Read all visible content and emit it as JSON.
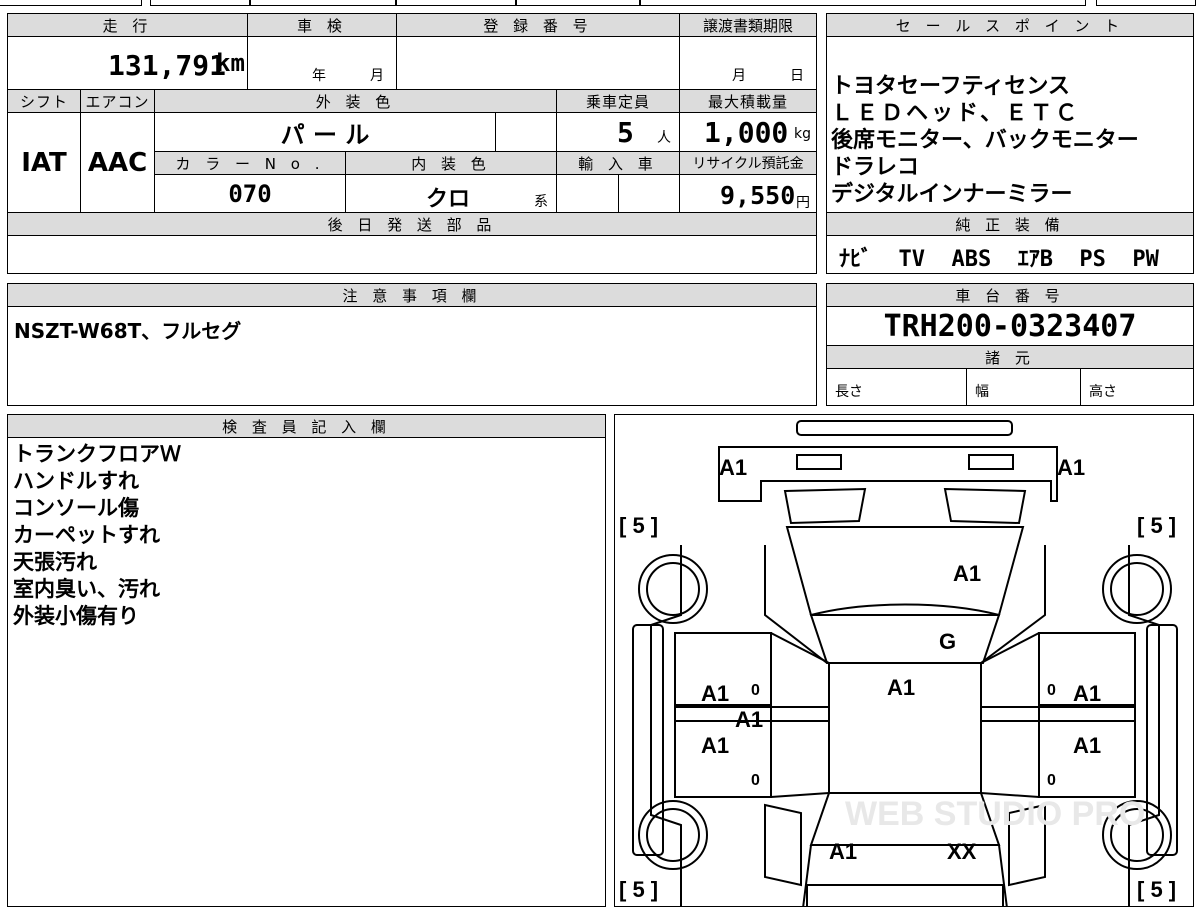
{
  "labels": {
    "mileage": "走 行",
    "inspection": "車 検",
    "registration_no": "登 録 番 号",
    "transfer_deadline": "譲渡書類期限",
    "sales_point": "セ ー ル ス ポ イ ン ト",
    "shift": "シフト",
    "aircon": "エアコン",
    "exterior_color": "外 装 色",
    "capacity": "乗車定員",
    "max_load": "最大積載量",
    "color_no": "カ ラ ー N o .",
    "interior_color": "内 装 色",
    "import": "輸 入 車",
    "recycle": "リサイクル預託金",
    "later_parts": "後 日 発 送 部 品",
    "genuine_equipment": "純 正 装 備",
    "notes": "注 意 事 項 欄",
    "chassis_no": "車 台 番 号",
    "specs": "諸 元",
    "inspector": "検 査 員 記 入 欄"
  },
  "values": {
    "mileage": "131,791",
    "mileage_unit": "km",
    "inspection_year": "年",
    "inspection_month": "月",
    "deadline_month": "月",
    "deadline_day": "日",
    "shift": "IAT",
    "aircon": "AAC",
    "exterior_color": "パ ー ル",
    "capacity": "5",
    "capacity_unit": "人",
    "max_load": "1,000",
    "max_load_unit": "kg",
    "color_no": "070",
    "interior_color": "クロ",
    "interior_suffix": "系",
    "recycle": "9,550",
    "recycle_unit": "円",
    "genuine_equipment": "ﾅﾋﾞ  TV  ABS  ｴｱB  PS  PW",
    "notes": "NSZT-W68T、フルセグ",
    "chassis_no": "TRH200-0323407",
    "spec_length": "長さ",
    "spec_width": "幅",
    "spec_height": "高さ"
  },
  "sales_points": [
    "トヨタセーフティセンス",
    "ＬＥＤヘッド、ＥＴＣ",
    "後席モニター、バックモニター",
    "ドラレコ",
    "デジタルインナーミラー"
  ],
  "inspector_notes": [
    "トランクフロアＷ",
    "ハンドルすれ",
    "コンソール傷",
    "カーペットすれ",
    "天張汚れ",
    "室内臭い、汚れ",
    "外装小傷有り"
  ],
  "diagram": {
    "tire_mark": "[ 5 ]",
    "marks": {
      "top_left": "A1",
      "top_right": "A1",
      "windshield": "A1",
      "roof_front": "G",
      "roof": "A1",
      "left_front_door": "A1",
      "left_mid": "A1",
      "left_rear_door": "A1",
      "right_front_door": "A1",
      "right_rear_door": "A1",
      "rear_left": "A1",
      "rear_right": "XX",
      "zero": "0"
    },
    "watermark": "WEB STUDIO PRO"
  }
}
